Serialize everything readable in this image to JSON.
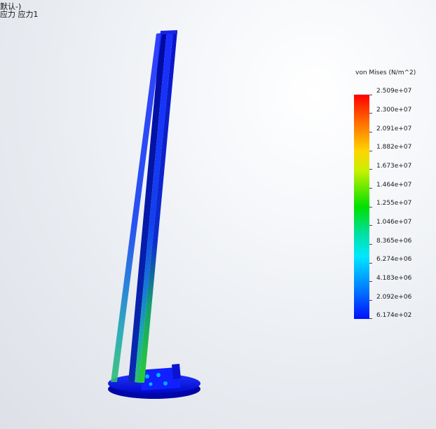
{
  "viewport": {
    "header_lines": [
      "",
      "默认-)",
      "应力 应力1"
    ]
  },
  "legend": {
    "title": "von Mises (N/m^2)",
    "labels": [
      "2.509e+07",
      "2.300e+07",
      "2.091e+07",
      "1.882e+07",
      "1.673e+07",
      "1.464e+07",
      "1.255e+07",
      "1.046e+07",
      "8.365e+06",
      "6.274e+06",
      "4.183e+06",
      "2.092e+06",
      "6.174e+02"
    ],
    "colors": {
      "max": "#ff0000",
      "mid": "#00e000",
      "min": "#0010ff"
    }
  }
}
